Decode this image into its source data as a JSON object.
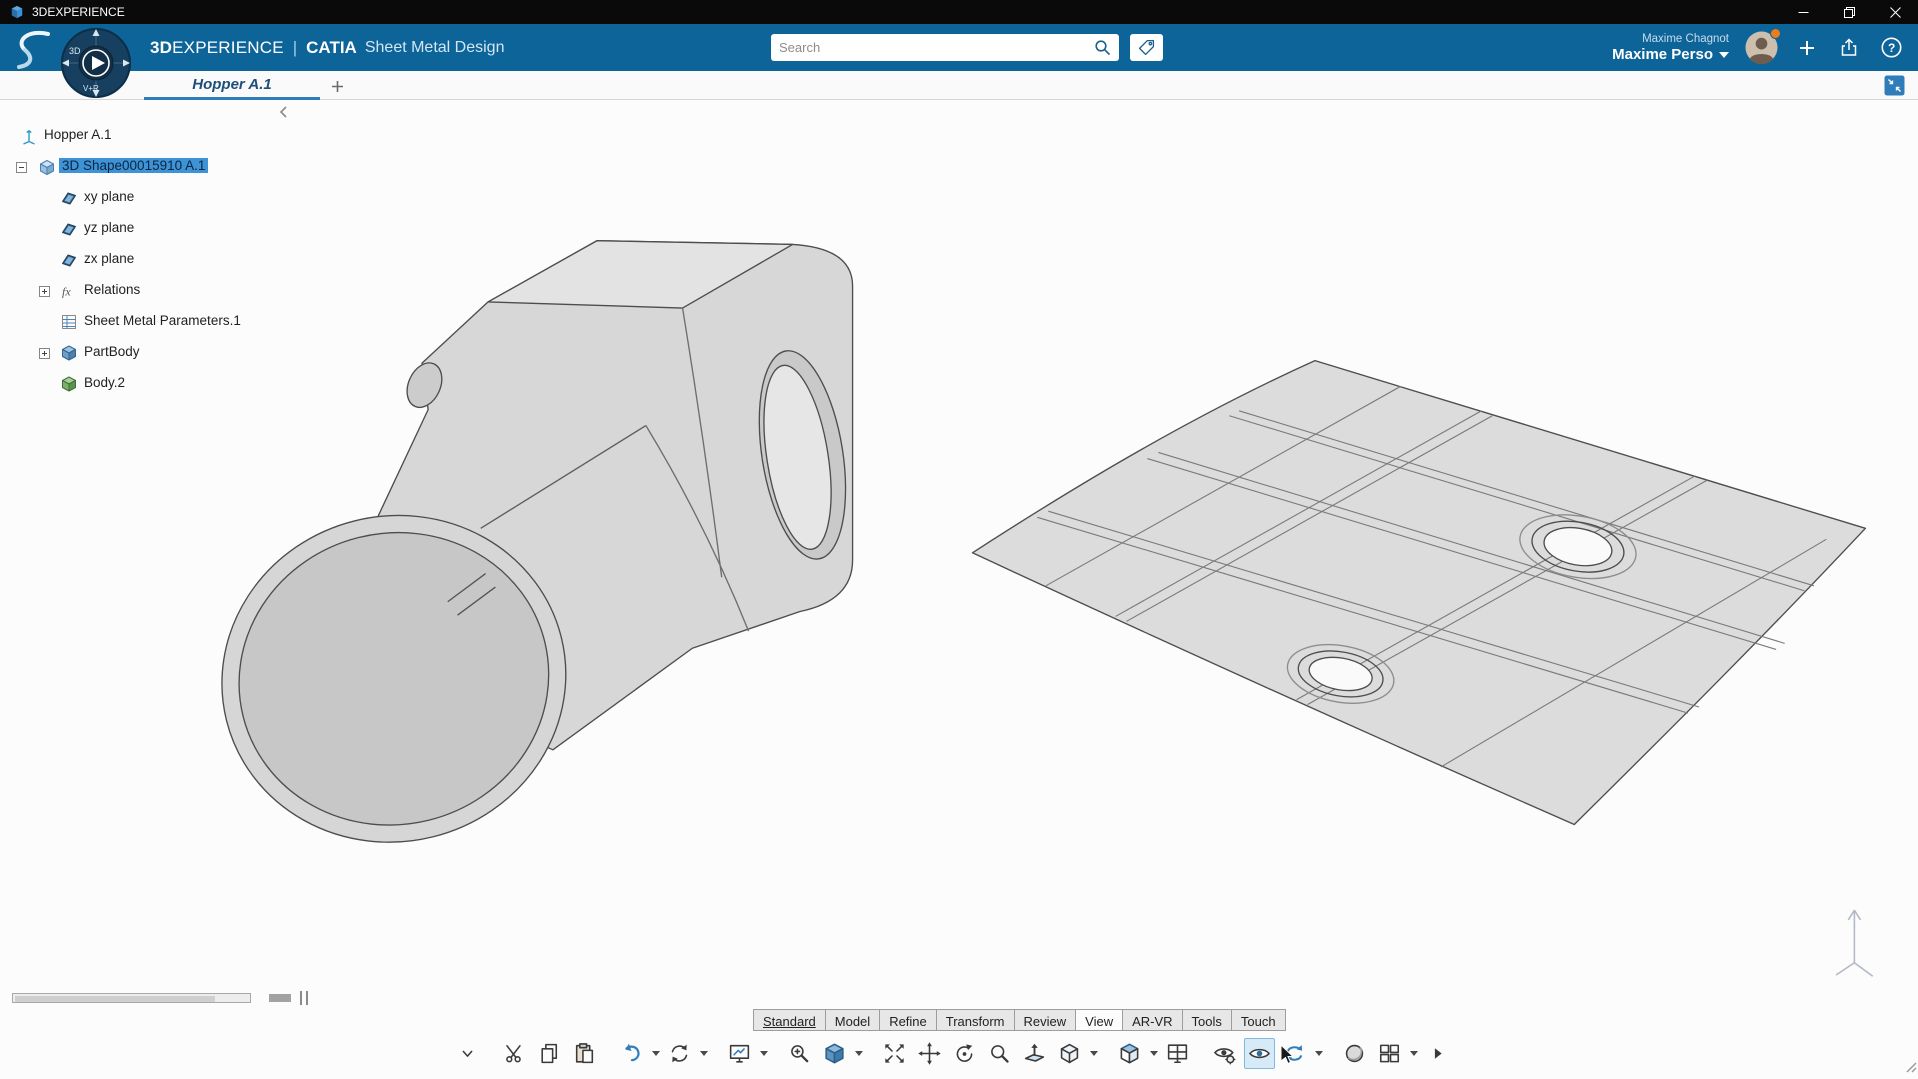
{
  "colors": {
    "header_bg": "#0d6499",
    "accent_blue": "#2e7dbe",
    "selection_blue": "#3e93d6",
    "tab_underline": "#2e7cb9"
  },
  "titlebar": {
    "app_title": "3DEXPERIENCE",
    "controls": [
      "minimize",
      "restore",
      "close"
    ]
  },
  "header": {
    "brand": {
      "bold": "3D",
      "light": "EXPERIENCE",
      "divider": "|",
      "app": "CATIA",
      "module": "Sheet Metal Design"
    },
    "compass": {
      "top_label": "3D",
      "bottom_label": "V+R"
    },
    "search": {
      "placeholder": "Search",
      "icons": [
        "search-icon",
        "tag-icon"
      ]
    },
    "user": {
      "account_name": "Maxime Chagnot",
      "profile_name": "Maxime Perso"
    },
    "action_icons": [
      "add-icon",
      "share-icon",
      "help-icon"
    ]
  },
  "tabbar": {
    "document_tab": "Hopper A.1",
    "new_tab_icon": "plus-icon",
    "collapse_icon": "collapse-viewport-icon"
  },
  "tree": {
    "items": [
      {
        "label": "Hopper A.1",
        "icon": "root-axes",
        "depth": 0
      },
      {
        "label": "3D Shape00015910 A.1",
        "icon": "shape3d",
        "depth": 1,
        "expander": "minus",
        "selected": true
      },
      {
        "label": "xy plane",
        "icon": "plane",
        "depth": 2
      },
      {
        "label": "yz plane",
        "icon": "plane",
        "depth": 2
      },
      {
        "label": "zx plane",
        "icon": "plane",
        "depth": 2
      },
      {
        "label": "Relations",
        "icon": "fx",
        "depth": 2,
        "expander": "plus"
      },
      {
        "label": "Sheet Metal Parameters.1",
        "icon": "parameters",
        "depth": 2
      },
      {
        "label": "PartBody",
        "icon": "partbody",
        "depth": 2,
        "expander": "plus"
      },
      {
        "label": "Body.2",
        "icon": "body",
        "depth": 2
      }
    ]
  },
  "ribbon": {
    "tabs": [
      "Standard",
      "Model",
      "Refine",
      "Transform",
      "Review",
      "View",
      "AR-VR",
      "Tools",
      "Touch"
    ],
    "active_tab": "View",
    "underlined_tab": "Standard"
  },
  "toolbar": {
    "tools": [
      {
        "name": "toolbar-collapse",
        "icon": "chevron-down"
      },
      {
        "name": "cut",
        "icon": "scissors",
        "group": true
      },
      {
        "name": "copy",
        "icon": "copy"
      },
      {
        "name": "paste",
        "icon": "paste"
      },
      {
        "name": "undo",
        "icon": "undo",
        "dropdown": true,
        "group": true
      },
      {
        "name": "update",
        "icon": "sync",
        "dropdown": true
      },
      {
        "name": "view-modes",
        "icon": "view-modes",
        "dropdown": true,
        "group": true
      },
      {
        "name": "zoom-area",
        "icon": "zoom-area",
        "group": true
      },
      {
        "name": "shaded-view",
        "icon": "shaded-view",
        "dropdown": true
      },
      {
        "name": "fit-all",
        "icon": "fit-all",
        "group": true
      },
      {
        "name": "pan",
        "icon": "pan"
      },
      {
        "name": "rotate",
        "icon": "rotate"
      },
      {
        "name": "zoom",
        "icon": "zoom"
      },
      {
        "name": "normal-view",
        "icon": "normal-view"
      },
      {
        "name": "iso-view",
        "icon": "iso-view",
        "dropdown": true
      },
      {
        "name": "render-style",
        "icon": "render-style",
        "dropdown": true,
        "group": true
      },
      {
        "name": "multi-view",
        "icon": "multi-view"
      },
      {
        "name": "visibility-options",
        "icon": "visibility-options",
        "group": true
      },
      {
        "name": "hide-show",
        "icon": "hide-show",
        "hovered": true
      },
      {
        "name": "swap-visible-space",
        "icon": "swap-space",
        "dropdown": true
      },
      {
        "name": "ambience",
        "icon": "ambience",
        "group": true
      },
      {
        "name": "split-view",
        "icon": "split-view",
        "dropdown": true
      },
      {
        "name": "more-tools",
        "icon": "more"
      }
    ]
  }
}
